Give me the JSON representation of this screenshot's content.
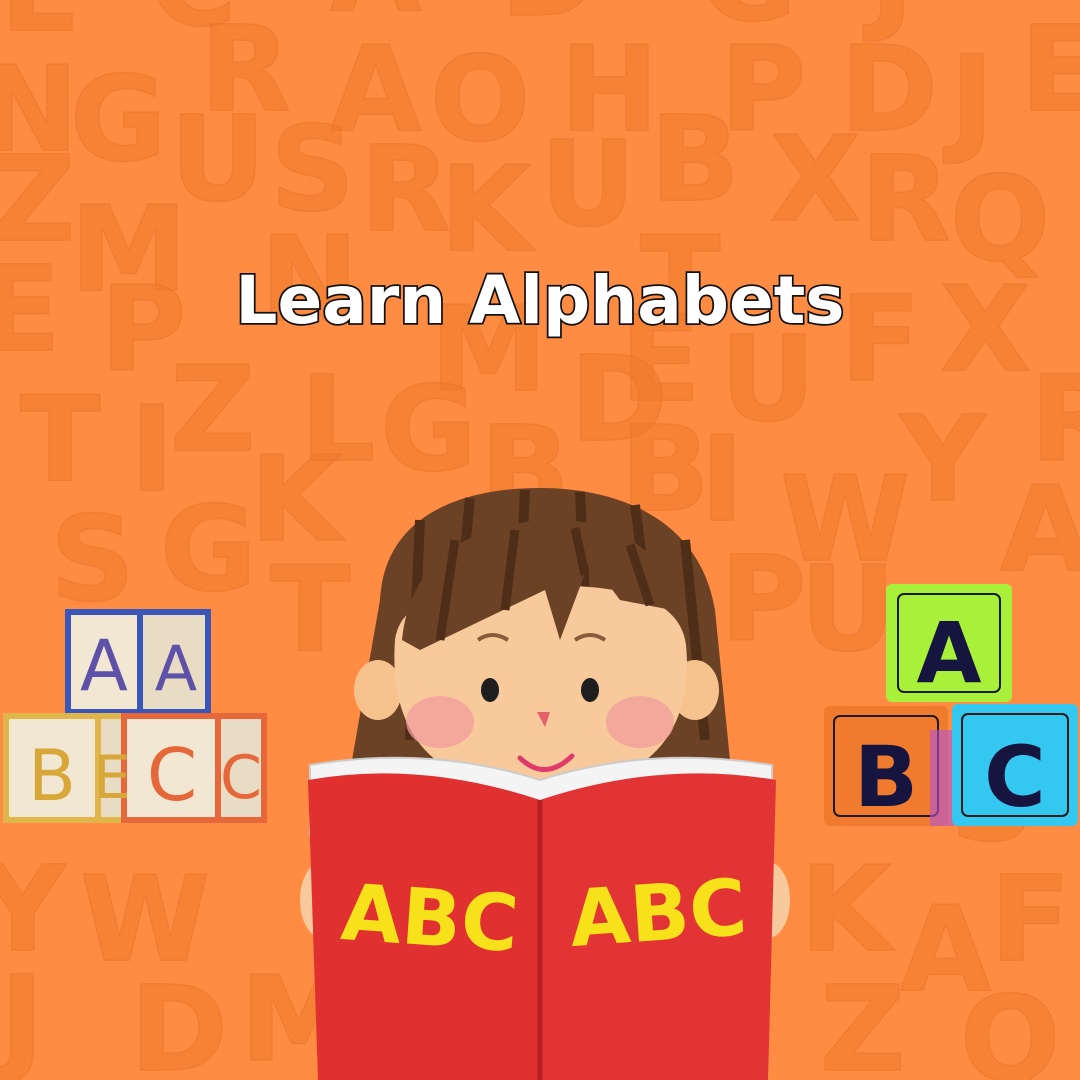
{
  "page": {
    "title": "Learn Alphabets"
  },
  "background_letters": [
    "L",
    "C",
    "A",
    "D",
    "G",
    "J",
    "N",
    "G",
    "R",
    "A",
    "O",
    "H",
    "P",
    "D",
    "J",
    "E",
    "U",
    "S",
    "R",
    "K",
    "U",
    "B",
    "X",
    "R",
    "Q",
    "Z",
    "M",
    "N",
    "T",
    "M",
    "E",
    "P",
    "E",
    "U",
    "F",
    "X",
    "T",
    "Z",
    "L",
    "G",
    "D",
    "I",
    "Y",
    "R",
    "B",
    "S",
    "G",
    "K",
    "B",
    "I",
    "W",
    "A",
    "P",
    "T",
    "U",
    "S",
    "W",
    "K",
    "A",
    "F",
    "Y",
    "J",
    "D",
    "M",
    "Z",
    "Q"
  ],
  "left_blocks": {
    "top": [
      "A",
      "A"
    ],
    "bottom": [
      "B",
      "E",
      "C",
      "C"
    ]
  },
  "right_blocks": {
    "top": "A",
    "bottom": [
      "B",
      "C"
    ]
  },
  "book": {
    "left_page_text": "ABC",
    "right_page_text": "ABC"
  },
  "colors": {
    "background": "#FF8C42",
    "title_fill": "#FFFFFF",
    "title_outline": "#111111",
    "book_red": "#E03030",
    "book_letters": "#F7E11A",
    "block_green": "#A8F03A",
    "block_orange": "#F07B2E",
    "block_cyan": "#34C8F0"
  },
  "icons": [
    "alphabet-pattern",
    "wooden-letter-blocks",
    "child-reading-book",
    "toy-letter-blocks"
  ]
}
